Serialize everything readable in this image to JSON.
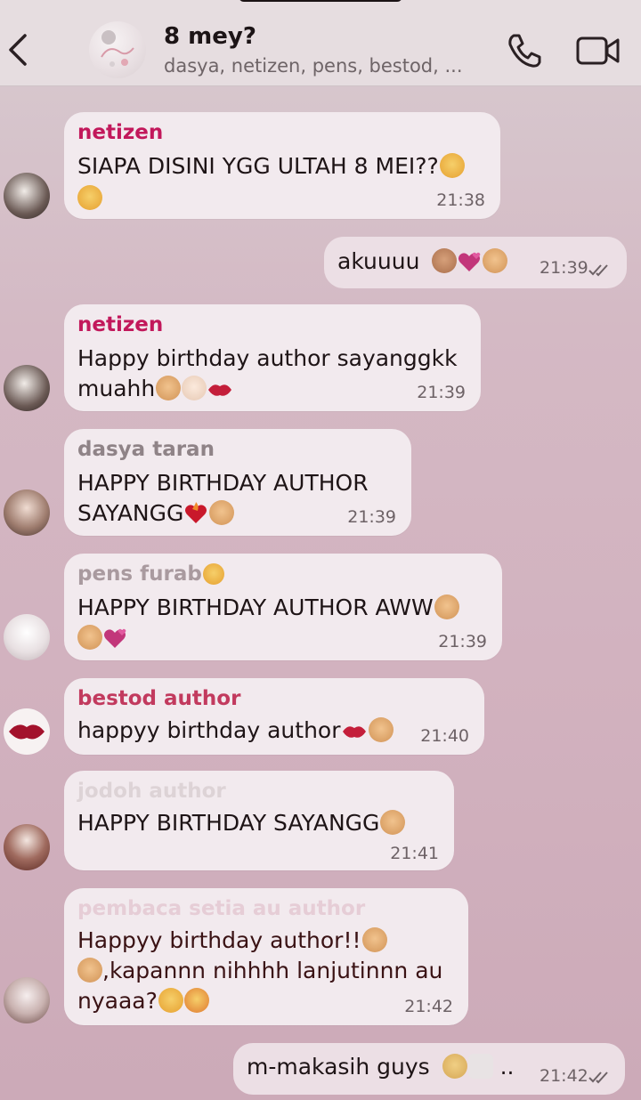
{
  "header": {
    "title": "8 mey?",
    "subtitle": "dasya, netizen, pens, bestod, ..."
  },
  "colors": {
    "netizen": "#c2185b",
    "dasya": "#8f8387",
    "pens": "#a99a9f",
    "bestod": "#c23a5e",
    "jodoh": "#ddd3d6",
    "pembaca": "#e6cdd6"
  },
  "messages": [
    {
      "sender": "netizen",
      "lines": [
        "SIAPA DISINI YGG ULTAH 8 MEI??",
        ""
      ],
      "emojis": [
        "grinning-squinting-face",
        "grinning-squinting-face"
      ],
      "time": "21:38"
    },
    {
      "sender": "",
      "lines": [
        "akuuuu"
      ],
      "emojis": [
        "person-tipping-hand",
        "revolving-hearts",
        "partying-face"
      ],
      "time": "21:39"
    },
    {
      "sender": "netizen",
      "lines": [
        "Happy birthday author sayanggkk",
        "muahh"
      ],
      "emojis": [
        "partying-face",
        "clapping-hands",
        "kiss-mark"
      ],
      "time": "21:39"
    },
    {
      "sender": "dasya taran",
      "lines": [
        "HAPPY BIRTHDAY AUTHOR",
        "SAYANGG"
      ],
      "emojis": [
        "heart-on-fire",
        "partying-face"
      ],
      "time": "21:39"
    },
    {
      "sender": "pens furab",
      "lines": [
        "HAPPY BIRTHDAY AUTHOR AWW",
        ""
      ],
      "emojis": [
        "relieved-face",
        "partying-face",
        "partying-face",
        "revolving-hearts"
      ],
      "time": "21:39"
    },
    {
      "sender": "bestod author",
      "lines": [
        "happyy birthday author"
      ],
      "emojis": [
        "kiss-mark",
        "partying-face"
      ],
      "time": "21:40"
    },
    {
      "sender": "jodoh author",
      "lines": [
        "HAPPY BIRTHDAY SAYANGG"
      ],
      "emojis": [
        "partying-face"
      ],
      "time": "21:41"
    },
    {
      "sender": "pembaca setia au author",
      "lines": [
        "Happyy birthday author!!",
        ",kapannn nihhhh lanjutinnn au",
        "nyaaa?"
      ],
      "emojis": [
        "partying-face",
        "partying-face",
        "grinning-squinting-face",
        "heart-eyes-face"
      ],
      "time": "21:42"
    },
    {
      "sender": "",
      "lines": [
        "m-makasih guys",
        ".."
      ],
      "emojis": [
        "pleading-face",
        "white-heart"
      ],
      "time": "21:42"
    }
  ]
}
